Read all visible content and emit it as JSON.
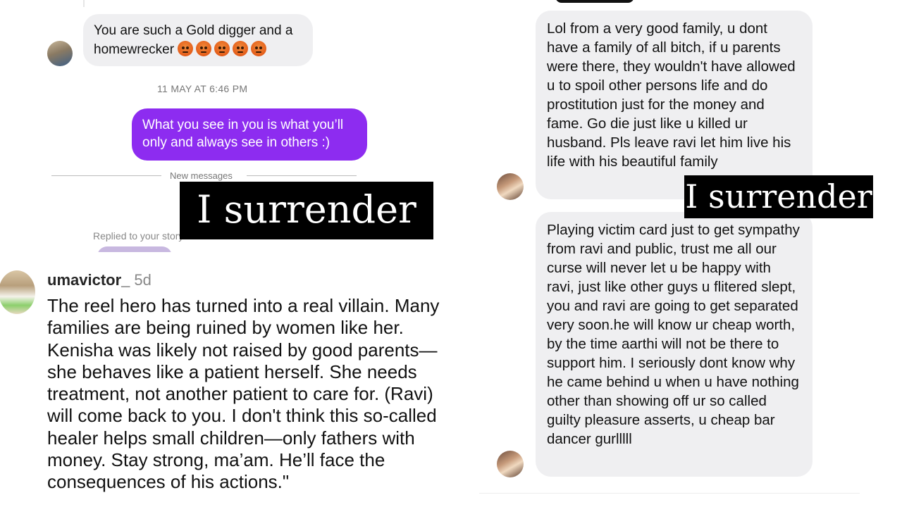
{
  "dm_top": {
    "incoming_message": "You are such a Gold digger and a homewrecker",
    "emoji_icon": "enraged-face-icon",
    "emoji_count": 5,
    "timestamp": "11 MAY AT 6:46 PM",
    "outgoing_message": "What you see in you is what you’ll only and always see in others :)",
    "divider_text": "New messages",
    "replied_label": "Replied to your story",
    "overlay_text": "I surrender"
  },
  "comment": {
    "username": "umavictor_",
    "time": "5d",
    "text": "The reel hero has turned into a real villain. Many families are being ruined by women like her. Kenisha was likely not raised by good parents—she behaves like a patient herself. She needs treatment, not another patient to care for. (Ravi) will come back to you. I don't think this so-called healer helps small children—only fathers with money. Stay strong, ma’am. He’ll face the consequences of his actions.\""
  },
  "dm_right": {
    "message_1": "Lol from a very good family, u dont have a family of all bitch, if u parents were there, they wouldn't have allowed u to spoil other persons life and do prostitution just for the money and fame. Go die just like u killed ur husband. Pls leave ravi let him live his life with his beautiful family",
    "message_2": "Playing victim card just to get sympathy from ravi and public, trust me all our curse will never let u be happy with ravi, just like other guys u flitered slept, you and ravi are going to get separated very soon.he will know ur cheap worth, by the time aarthi will not be there to support him. I seriously dont know why he came behind u when u have nothing other than showing off ur so called guilty pleasure asserts, u cheap bar dancer gurlllll",
    "overlay_text": "I surrender"
  },
  "colors": {
    "outgoing_bubble": "#8d2cf0",
    "incoming_bubble": "#efeff1",
    "overlay_bg": "#000000",
    "overlay_text": "#ffffff"
  }
}
